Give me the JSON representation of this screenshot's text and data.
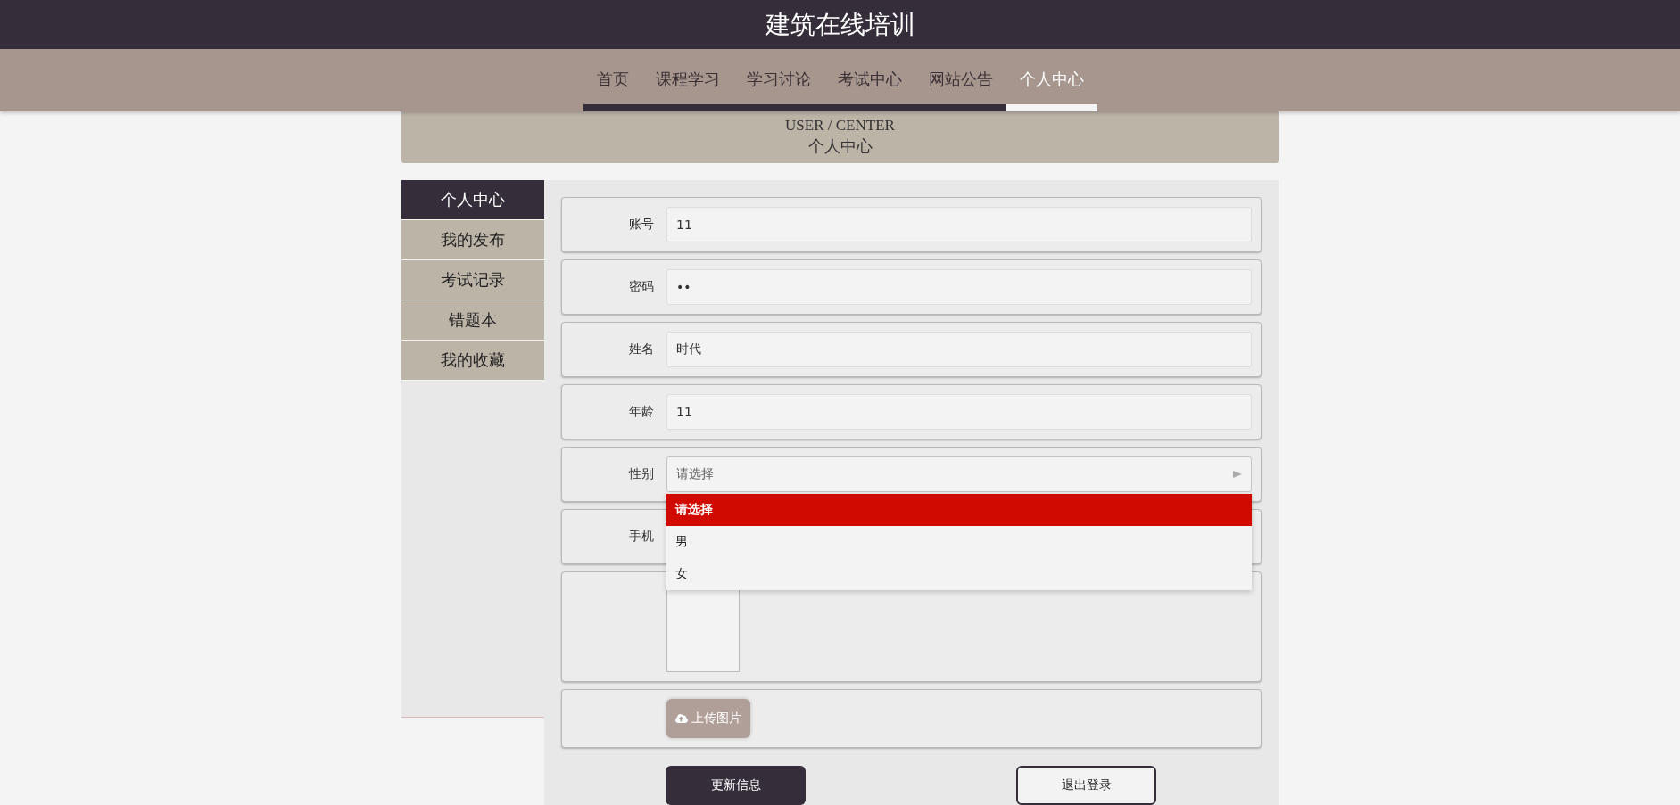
{
  "header": {
    "title": "建筑在线培训"
  },
  "nav": [
    {
      "label": "首页",
      "selected": false
    },
    {
      "label": "课程学习",
      "selected": false
    },
    {
      "label": "学习讨论",
      "selected": false
    },
    {
      "label": "考试中心",
      "selected": false
    },
    {
      "label": "网站公告",
      "selected": false
    },
    {
      "label": "个人中心",
      "selected": true
    }
  ],
  "banner": {
    "title": "USER / CENTER",
    "subtitle": "个人中心"
  },
  "sidebar": [
    {
      "label": "个人中心",
      "selected": true
    },
    {
      "label": "我的发布",
      "selected": false
    },
    {
      "label": "考试记录",
      "selected": false
    },
    {
      "label": "错题本",
      "selected": false
    },
    {
      "label": "我的收藏",
      "selected": false
    }
  ],
  "form": {
    "fields": [
      {
        "kind": "text",
        "label": "账号",
        "value": "11"
      },
      {
        "kind": "text",
        "label": "密码",
        "value": "••"
      },
      {
        "kind": "text",
        "label": "姓名",
        "value": "时代"
      },
      {
        "kind": "text",
        "label": "年龄",
        "value": "11"
      },
      {
        "kind": "select",
        "label": "性别",
        "placeholder": "请选择",
        "expanded": true,
        "options": [
          {
            "label": "请选择",
            "selected": true
          },
          {
            "label": "男",
            "selected": false
          },
          {
            "label": "女",
            "selected": false
          }
        ]
      },
      {
        "kind": "text",
        "label": "手机"
      },
      {
        "kind": "image"
      },
      {
        "kind": "upload",
        "button": "上传图片"
      }
    ],
    "buttons": [
      {
        "kind": "primary",
        "label": "更新信息"
      },
      {
        "kind": "outline",
        "label": "退出登录"
      }
    ]
  }
}
